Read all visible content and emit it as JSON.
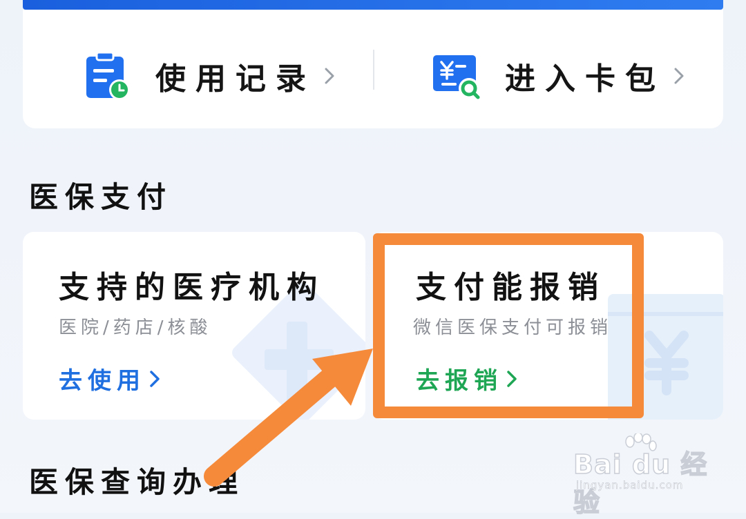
{
  "quick_actions": {
    "usage_record": {
      "label": "使用记录",
      "icon": "clipboard-clock-icon"
    },
    "card_wallet": {
      "label": "进入卡包",
      "icon": "yuan-search-icon"
    }
  },
  "sections": {
    "payment_title": "医保支付",
    "query_title": "医保查询办理"
  },
  "services": [
    {
      "title": "支持的医疗机构",
      "subtitle": "医院/药店/核酸",
      "action": "去使用",
      "action_color": "#1f6fe0"
    },
    {
      "title": "支付能报销",
      "subtitle": "微信医保支付可报销",
      "action": "去报销",
      "action_color": "#1fa655"
    }
  ],
  "watermark": {
    "brand": "Bai du 经验",
    "url": "jingyan.baidu.com"
  },
  "colors": {
    "primary_blue": "#1a60de",
    "action_blue": "#1f6fe0",
    "action_green": "#1fa655",
    "highlight_orange": "#f68a3b"
  }
}
